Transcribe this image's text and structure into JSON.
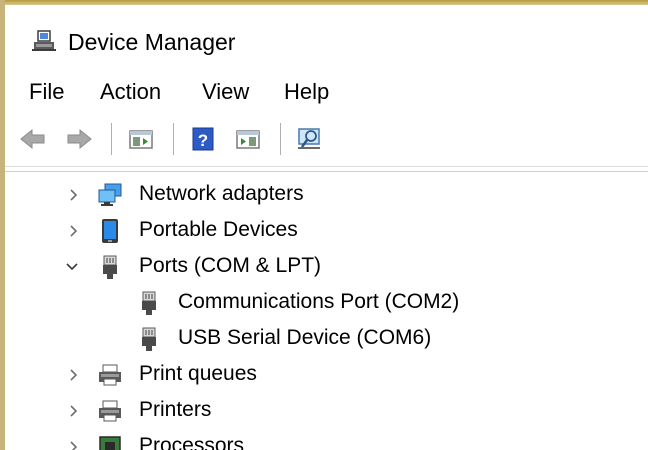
{
  "window": {
    "title": "Device Manager",
    "title_icon": "device-manager-icon"
  },
  "menu": {
    "items": [
      "File",
      "Action",
      "View",
      "Help"
    ]
  },
  "toolbar": {
    "buttons": [
      {
        "icon": "back-arrow-icon"
      },
      {
        "icon": "forward-arrow-icon"
      },
      {
        "icon": "show-hide-console-tree-icon"
      },
      {
        "icon": "help-icon"
      },
      {
        "icon": "properties-icon"
      },
      {
        "icon": "scan-hardware-changes-icon"
      }
    ]
  },
  "tree": {
    "nodes": [
      {
        "label": "Network adapters",
        "icon": "network-adapter-icon",
        "expanded": false,
        "level": 0
      },
      {
        "label": "Portable Devices",
        "icon": "portable-device-icon",
        "expanded": false,
        "level": 0
      },
      {
        "label": "Ports (COM & LPT)",
        "icon": "port-connector-icon",
        "expanded": true,
        "level": 0
      },
      {
        "label": "Communications Port (COM2)",
        "icon": "port-connector-icon",
        "level": 1
      },
      {
        "label": "USB Serial Device (COM6)",
        "icon": "port-connector-icon",
        "level": 1
      },
      {
        "label": "Print queues",
        "icon": "printer-icon",
        "expanded": false,
        "level": 0
      },
      {
        "label": "Printers",
        "icon": "printer-icon",
        "expanded": false,
        "level": 0
      },
      {
        "label": "Processors",
        "icon": "processor-icon",
        "expanded": false,
        "level": 0
      }
    ]
  },
  "colors": {
    "accent_blue": "#1e73d2",
    "chevron": "#6e6e6e"
  }
}
